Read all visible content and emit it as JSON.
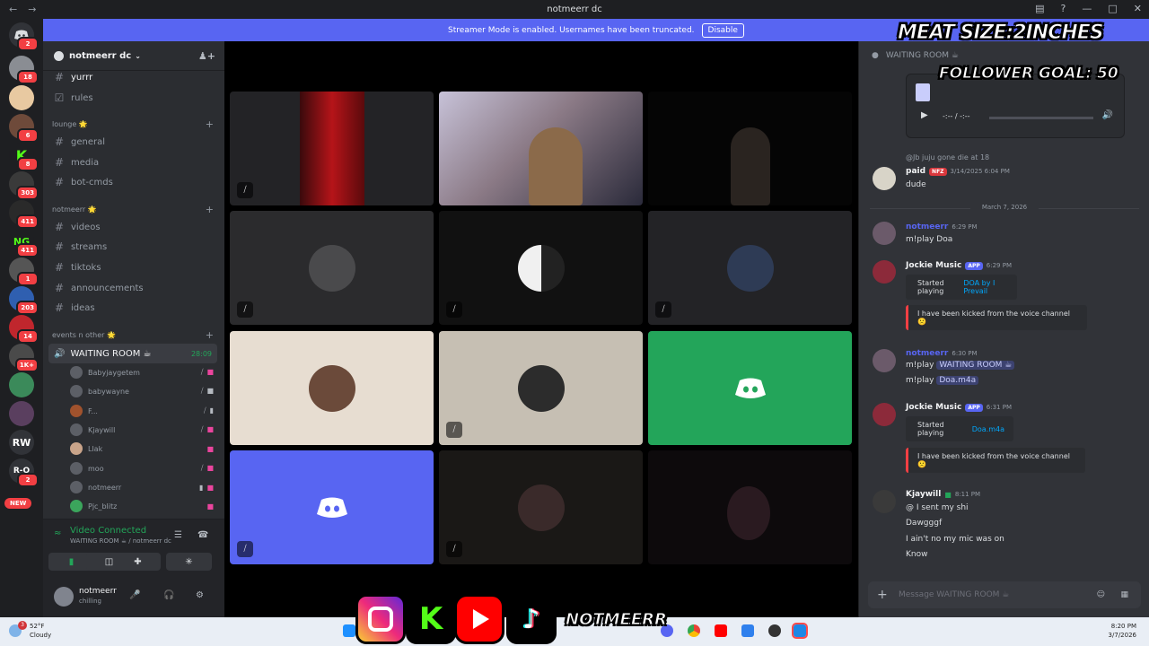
{
  "window": {
    "title": "notmeerr dc"
  },
  "banner": {
    "text": "Streamer Mode is enabled. Usernames have been truncated.",
    "button": "Disable"
  },
  "server_rail": {
    "items": [
      {
        "badge": "2"
      },
      {
        "badge": "18"
      },
      {
        "badge": ""
      },
      {
        "badge": "6"
      },
      {
        "badge": "8"
      },
      {
        "badge": "303"
      },
      {
        "badge": "411"
      },
      {
        "badge": "411"
      },
      {
        "badge": "1"
      },
      {
        "badge": "203"
      },
      {
        "badge": "14"
      },
      {
        "badge": "1K+"
      },
      {
        "badge": ""
      },
      {
        "badge": ""
      },
      {
        "label": "RW"
      },
      {
        "label": "R-O",
        "badge": "2"
      }
    ],
    "new_label": "NEW"
  },
  "sidebar": {
    "server_name": "notmeerr dc",
    "channels_top": [
      {
        "name": "yurrr"
      },
      {
        "name": "rules"
      }
    ],
    "cat1": "lounge 🌟",
    "channels_lounge": [
      {
        "name": "general"
      },
      {
        "name": "media"
      },
      {
        "name": "bot-cmds"
      }
    ],
    "cat2": "notmeerr 🌟",
    "channels_notmeerr": [
      {
        "name": "videos"
      },
      {
        "name": "streams"
      },
      {
        "name": "tiktoks"
      },
      {
        "name": "announcements"
      },
      {
        "name": "ideas"
      }
    ],
    "cat3": "events n other 🌟",
    "voice_channel": {
      "name": "WAITING ROOM ☕",
      "timer": "28:09"
    },
    "voice_users": [
      "Babyjaygetem",
      "babywayne",
      "F...",
      "Kjaywill",
      "Llak",
      "moo",
      "notmeerr",
      "Pjc_blitz"
    ]
  },
  "voice_panel": {
    "status": "Video Connected",
    "location": "WAITING ROOM ☕ / notmeerr dc"
  },
  "user_panel": {
    "name": "notmeerr",
    "status": "chilling"
  },
  "chat": {
    "header": "WAITING ROOM ☕",
    "audio_time": "-:-- / -:--",
    "reply_context": "@Jb juju gone die at 18",
    "m1": {
      "author": "paid",
      "tag": "NFZ",
      "time": "3/14/2025 6:04 PM",
      "text": "dude"
    },
    "date_sep": "March 7, 2026",
    "m2": {
      "time": "6:29 PM",
      "text": "m!play Doa"
    },
    "m3": {
      "author": "Jockie Music",
      "tag": "APP",
      "time": "6:29 PM",
      "embed1_prefix": "Started playing",
      "embed1_link": "DOA by I Prevail",
      "embed2": "I have been kicked from the voice channel 🙁"
    },
    "m4": {
      "time": "6:30 PM",
      "line1_prefix": "m!play",
      "line1_mention": "WAITING ROOM ☕",
      "line2_prefix": "m!play",
      "line2_mention": "Doa.m4a"
    },
    "m5": {
      "author": "Jockie Music",
      "tag": "APP",
      "time": "6:31 PM",
      "embed1_prefix": "Started playing",
      "embed1_link": "Doa.m4a",
      "embed2": "I have been kicked from the voice channel 🙁"
    },
    "m6": {
      "author": "Kjaywill",
      "time": "8:11 PM",
      "lines": [
        "@ I sent my shi",
        "Dawgggf",
        "I ain't no my mic was on",
        "Know"
      ]
    },
    "composer_placeholder": "Message WAITING ROOM ☕"
  },
  "overlays": {
    "meat": "MEAT SIZE:2INCHES",
    "goal": "FOLLOWER GOAL: 50",
    "handle": "NOTMEERR"
  },
  "taskbar": {
    "temp": "52°F",
    "cond": "Cloudy",
    "weather_badge": "3",
    "time": "8:20 PM",
    "date": "3/7/2026"
  }
}
